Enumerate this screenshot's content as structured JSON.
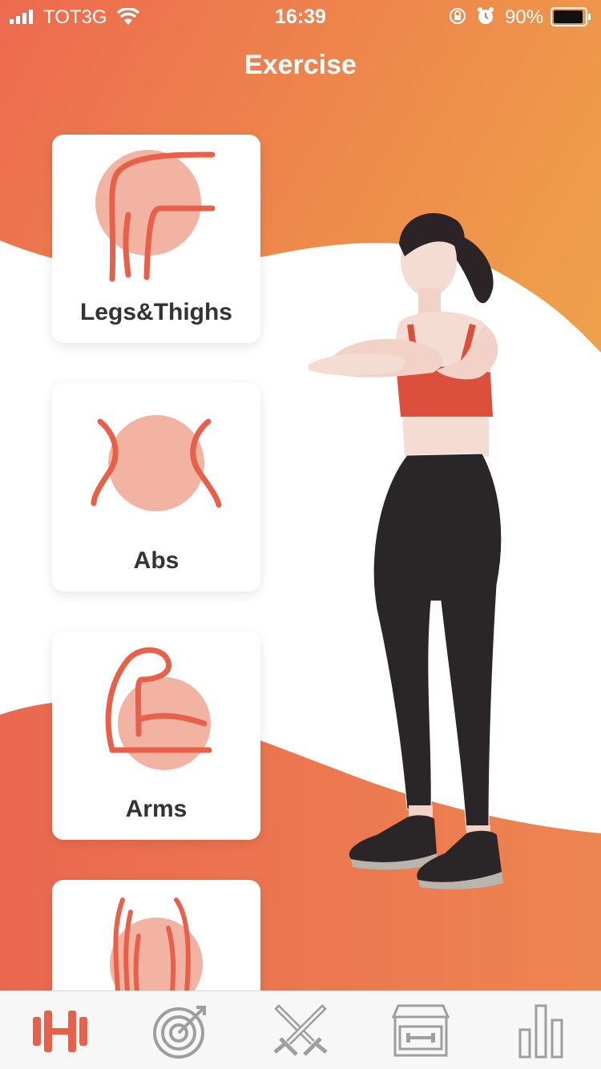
{
  "status_bar": {
    "carrier": "TOT3G",
    "time": "16:39",
    "battery": "90%"
  },
  "header": {
    "title": "Exercise"
  },
  "categories": [
    {
      "label": "Legs&Thighs",
      "icon": "legs-icon"
    },
    {
      "label": "Abs",
      "icon": "abs-icon"
    },
    {
      "label": "Arms",
      "icon": "arms-icon"
    },
    {
      "label": "",
      "icon": "back-icon"
    }
  ],
  "tab_bar": {
    "items": [
      {
        "icon": "dumbbell-icon",
        "active": true
      },
      {
        "icon": "target-icon",
        "active": false
      },
      {
        "icon": "crossed-swords-icon",
        "active": false
      },
      {
        "icon": "gym-store-icon",
        "active": false
      },
      {
        "icon": "bar-chart-icon",
        "active": false
      }
    ]
  },
  "colors": {
    "accent": "#E8604A",
    "gradient_top": "#ED6D4E",
    "gradient_mid": "#EFA24A",
    "icon_fill": "#F3B3A2",
    "card_text": "#333333",
    "tab_inactive": "#9E9E9E"
  }
}
